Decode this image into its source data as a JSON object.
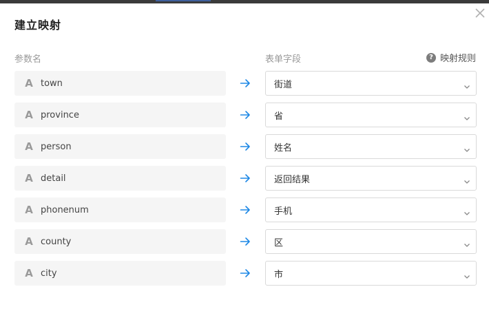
{
  "dialog": {
    "title": "建立映射",
    "param_header": "参数名",
    "field_header": "表单字段",
    "rule_icon": "question-circle-icon",
    "rule_label": "映射规则",
    "close_icon": "close-icon"
  },
  "rows": [
    {
      "param": "town",
      "field": "街道"
    },
    {
      "param": "province",
      "field": "省"
    },
    {
      "param": "person",
      "field": "姓名"
    },
    {
      "param": "detail",
      "field": "返回结果"
    },
    {
      "param": "phonenum",
      "field": "手机"
    },
    {
      "param": "county",
      "field": "区"
    },
    {
      "param": "city",
      "field": "市"
    }
  ],
  "param_type_glyph": "A",
  "colors": {
    "arrow": "#1e88e5",
    "param_bg": "#f5f5f5",
    "border": "#d9d9d9"
  }
}
